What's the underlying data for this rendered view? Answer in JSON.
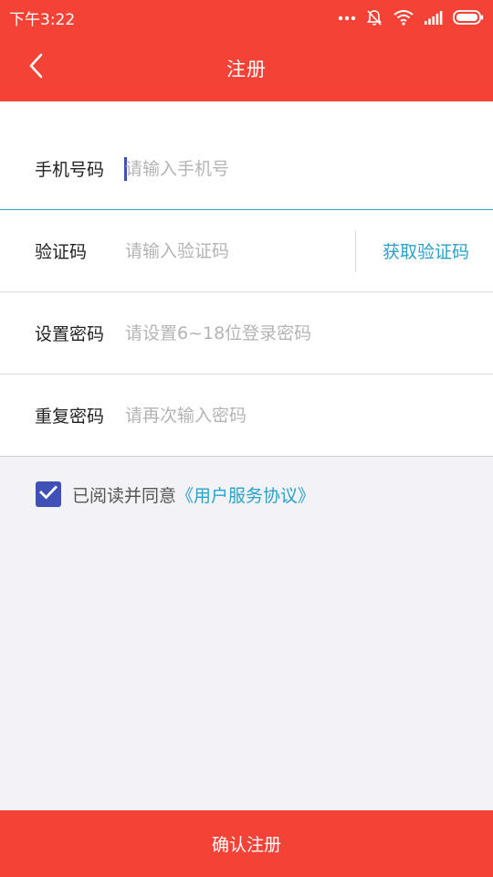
{
  "status_bar": {
    "time": "下午3:22",
    "icons": [
      "more-dots-icon",
      "bell-off-icon",
      "wifi-icon",
      "signal-icon",
      "battery-icon"
    ]
  },
  "header": {
    "title": "注册",
    "back_icon": "chevron-left-icon"
  },
  "form": {
    "phone": {
      "label": "手机号码",
      "placeholder": "请输入手机号",
      "value": ""
    },
    "code": {
      "label": "验证码",
      "placeholder": "请输入验证码",
      "value": "",
      "action": "获取验证码"
    },
    "password": {
      "label": "设置密码",
      "placeholder": "请设置6~18位登录密码",
      "value": ""
    },
    "confirm_password": {
      "label": "重复密码",
      "placeholder": "请再次输入密码",
      "value": ""
    }
  },
  "agreement": {
    "checked": true,
    "text": "已阅读并同意",
    "link": "《用户服务协议》"
  },
  "footer": {
    "submit_label": "确认注册"
  },
  "colors": {
    "primary": "#f44336",
    "accent": "#2aa1c8",
    "checkbox": "#3f51b5",
    "background": "#f3f3f7"
  }
}
